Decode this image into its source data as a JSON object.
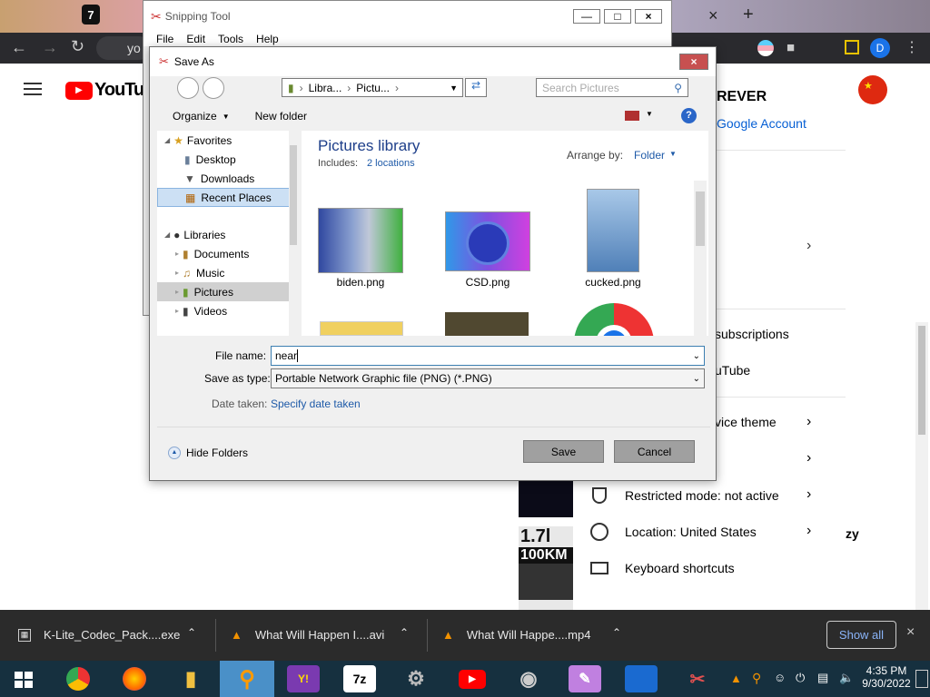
{
  "chrome": {
    "tabs": [
      {
        "label": "7"
      },
      {
        "label": "×"
      },
      {
        "label": "+"
      }
    ],
    "address": "yo",
    "profile_initial": "D"
  },
  "youtube": {
    "logo_text": "YouTube",
    "account_name": "REVER",
    "account_link": "Google Account",
    "menu": [
      {
        "label": "subscriptions"
      },
      {
        "label": "uTube"
      },
      {
        "label": "vice theme"
      },
      {
        "label": "Restricted mode: not active"
      },
      {
        "label": "Location: United States"
      },
      {
        "label": "Keyboard shortcuts"
      }
    ],
    "side_text": "zy",
    "thumb_text_1": "1.7l",
    "thumb_text_2": "100KM"
  },
  "snipping_tool": {
    "title": "Snipping Tool",
    "menu": [
      "File",
      "Edit",
      "Tools",
      "Help"
    ]
  },
  "dialog": {
    "title": "Save As",
    "breadcrumb": [
      "Libra...",
      "Pictu..."
    ],
    "search_placeholder": "Search Pictures",
    "organize": "Organize",
    "new_folder": "New folder",
    "nav": {
      "favorites_header": "Favorites",
      "favorites": [
        "Desktop",
        "Downloads",
        "Recent Places"
      ],
      "libraries_header": "Libraries",
      "libraries": [
        "Documents",
        "Music",
        "Pictures",
        "Videos"
      ]
    },
    "library_title": "Pictures library",
    "includes_label": "Includes:",
    "includes_link": "2 locations",
    "arrange_label": "Arrange by:",
    "arrange_value": "Folder",
    "files": [
      {
        "name": "biden.png"
      },
      {
        "name": "CSD.png"
      },
      {
        "name": "cucked.png"
      }
    ],
    "file_name_label": "File name:",
    "file_name_value": "near",
    "save_type_label": "Save as type:",
    "save_type_value": "Portable Network Graphic file (PNG) (*.PNG)",
    "date_taken_label": "Date taken:",
    "date_taken_link": "Specify date taken",
    "hide_folders": "Hide Folders",
    "save": "Save",
    "cancel": "Cancel"
  },
  "downloads": {
    "items": [
      {
        "name": "K-Lite_Codec_Pack....exe"
      },
      {
        "name": "What Will Happen I....avi"
      },
      {
        "name": "What Will Happe....mp4"
      }
    ],
    "show_all": "Show all"
  },
  "taskbar": {
    "time": "4:35 PM",
    "date": "9/30/2022"
  }
}
